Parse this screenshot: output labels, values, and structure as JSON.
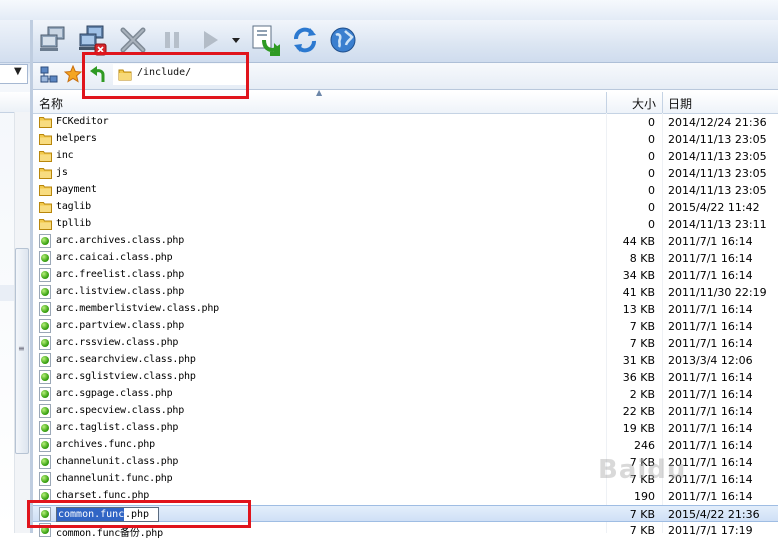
{
  "address": {
    "path": "/include/"
  },
  "columns": {
    "name": "名称",
    "size": "大小",
    "date": "日期"
  },
  "toolbar": {
    "buttons": [
      {
        "name": "connect",
        "icon": "network-computer-icon"
      },
      {
        "name": "disconnect",
        "icon": "network-disconnect-icon"
      },
      {
        "name": "stop",
        "icon": "stop-x-icon"
      },
      {
        "name": "pause",
        "icon": "pause-icon"
      },
      {
        "name": "play",
        "icon": "play-icon"
      },
      {
        "name": "play-dropdown",
        "icon": "dropdown-arrow-icon"
      },
      {
        "name": "transfer",
        "icon": "transfer-icon"
      },
      {
        "name": "refresh",
        "icon": "refresh-icon"
      },
      {
        "name": "globe",
        "icon": "globe-icon"
      }
    ]
  },
  "files": [
    {
      "name": "FCKeditor",
      "size": "0",
      "date": "2014/12/24 21:36",
      "type": "folder"
    },
    {
      "name": "helpers",
      "size": "0",
      "date": "2014/11/13 23:05",
      "type": "folder"
    },
    {
      "name": "inc",
      "size": "0",
      "date": "2014/11/13 23:05",
      "type": "folder"
    },
    {
      "name": "js",
      "size": "0",
      "date": "2014/11/13 23:05",
      "type": "folder"
    },
    {
      "name": "payment",
      "size": "0",
      "date": "2014/11/13 23:05",
      "type": "folder"
    },
    {
      "name": "taglib",
      "size": "0",
      "date": "2015/4/22 11:42",
      "type": "folder"
    },
    {
      "name": "tpllib",
      "size": "0",
      "date": "2014/11/13 23:11",
      "type": "folder"
    },
    {
      "name": "arc.archives.class.php",
      "size": "44 KB",
      "date": "2011/7/1 16:14",
      "type": "php"
    },
    {
      "name": "arc.caicai.class.php",
      "size": "8 KB",
      "date": "2011/7/1 16:14",
      "type": "php"
    },
    {
      "name": "arc.freelist.class.php",
      "size": "34 KB",
      "date": "2011/7/1 16:14",
      "type": "php"
    },
    {
      "name": "arc.listview.class.php",
      "size": "41 KB",
      "date": "2011/11/30 22:19",
      "type": "php"
    },
    {
      "name": "arc.memberlistview.class.php",
      "size": "13 KB",
      "date": "2011/7/1 16:14",
      "type": "php"
    },
    {
      "name": "arc.partview.class.php",
      "size": "7 KB",
      "date": "2011/7/1 16:14",
      "type": "php"
    },
    {
      "name": "arc.rssview.class.php",
      "size": "7 KB",
      "date": "2011/7/1 16:14",
      "type": "php"
    },
    {
      "name": "arc.searchview.class.php",
      "size": "31 KB",
      "date": "2013/3/4 12:06",
      "type": "php"
    },
    {
      "name": "arc.sglistview.class.php",
      "size": "36 KB",
      "date": "2011/7/1 16:14",
      "type": "php"
    },
    {
      "name": "arc.sgpage.class.php",
      "size": "2 KB",
      "date": "2011/7/1 16:14",
      "type": "php"
    },
    {
      "name": "arc.specview.class.php",
      "size": "22 KB",
      "date": "2011/7/1 16:14",
      "type": "php"
    },
    {
      "name": "arc.taglist.class.php",
      "size": "19 KB",
      "date": "2011/7/1 16:14",
      "type": "php"
    },
    {
      "name": "archives.func.php",
      "size": "246",
      "date": "2011/7/1 16:14",
      "type": "php"
    },
    {
      "name": "channelunit.class.php",
      "size": "7 KB",
      "date": "2011/7/1 16:14",
      "type": "php"
    },
    {
      "name": "channelunit.func.php",
      "size": "7 KB",
      "date": "2011/7/1 16:14",
      "type": "php"
    },
    {
      "name": "charset.func.php",
      "size": "190",
      "date": "2011/7/1 16:14",
      "type": "php"
    },
    {
      "name": "common.func.php",
      "size": "7 KB",
      "date": "2015/4/22 21:36",
      "type": "php",
      "selected": true,
      "rename_selected": "common.func",
      "rename_rest": ".php"
    },
    {
      "name": "common.func备份.php",
      "size": "7 KB",
      "date": "2011/7/1 17:19",
      "type": "php"
    }
  ],
  "watermark": "Baidu"
}
